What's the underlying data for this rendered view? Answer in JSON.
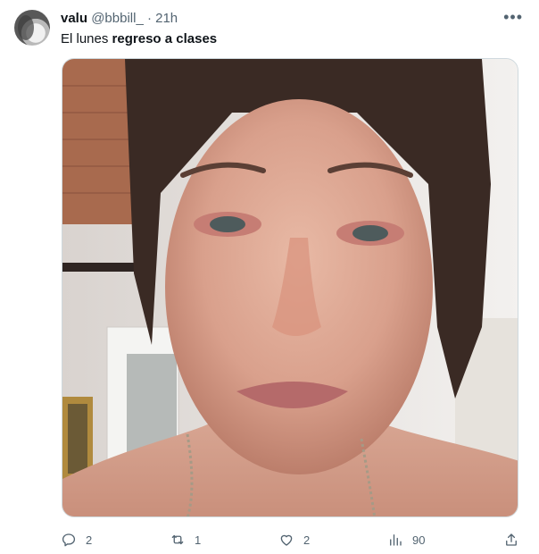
{
  "tweet": {
    "author": {
      "name": "valu",
      "handle": "@bbbill_",
      "separator": "·",
      "time": "21h"
    },
    "more_icon": "more-horizontal-icon",
    "text_regular": "El lunes ",
    "text_bold": "regreso a clases",
    "media": {
      "kind": "photo",
      "description_visible": false
    },
    "actions": {
      "reply": {
        "icon": "reply-icon",
        "count": "2"
      },
      "retweet": {
        "icon": "retweet-icon",
        "count": "1"
      },
      "like": {
        "icon": "heart-icon",
        "count": "2"
      },
      "views": {
        "icon": "views-chart-icon",
        "count": "90"
      },
      "share": {
        "icon": "share-icon"
      }
    }
  }
}
